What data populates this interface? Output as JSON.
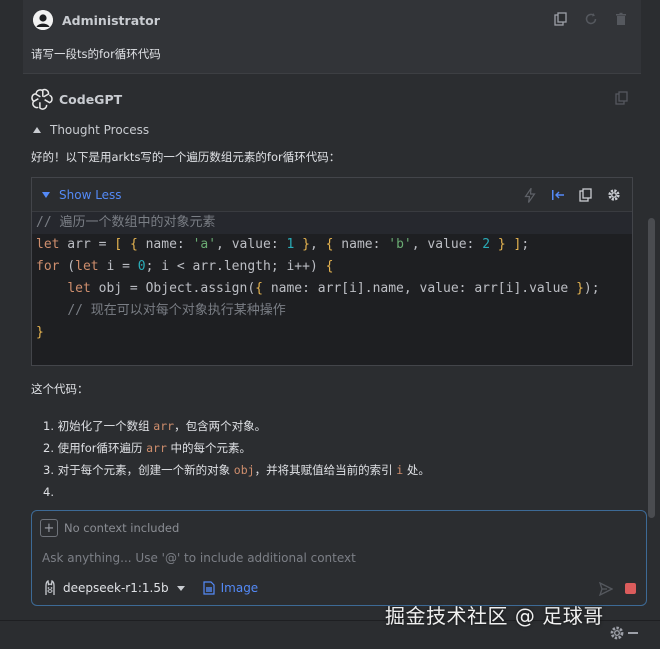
{
  "user": {
    "name": "Administrator",
    "message": "请写一段ts的for循环代码"
  },
  "assistant": {
    "name": "CodeGPT",
    "thought_label": "Thought Process",
    "intro": "好的！以下是用arkts写的一个遍历数组元素的for循环代码：",
    "code_block": {
      "toggle_label": "Show Less",
      "lines": [
        "// 遍历一个数组中的对象元素",
        "let arr = [ { name: 'a', value: 1 }, { name: 'b', value: 2 } ];",
        "for (let i = 0; i < arr.length; i++) {",
        "    let obj = Object.assign({ name: arr[i].name, value: arr[i].value });",
        "    // 现在可以对每个对象执行某种操作",
        "}"
      ]
    },
    "explain_title": "这个代码：",
    "explain_items": [
      {
        "num": "1.",
        "before": "初始化了一个数组 ",
        "code": "arr",
        "after": "，包含两个对象。"
      },
      {
        "num": "2.",
        "before": "使用for循环遍历 ",
        "code": "arr",
        "after": " 中的每个元素。"
      },
      {
        "num": "3.",
        "before": "对于每个元素，创建一个新的对象 ",
        "code": "obj",
        "after": "，并将其赋值给当前的索引 ",
        "code2": "i",
        "after2": " 处。"
      },
      {
        "num": "4.",
        "before": "",
        "code": "",
        "after": ""
      }
    ]
  },
  "input": {
    "context_text": "No context included",
    "placeholder": "Ask anything... Use '@' to include additional context",
    "value": "",
    "model": "deepseek-r1:1.5b",
    "image_label": "Image"
  },
  "watermark": "掘金技术社区 @ 足球哥",
  "colors": {
    "background": "#2b2d30",
    "code_background": "#1e1f22",
    "accent": "#548af7",
    "keyword": "#cf8e6d",
    "string": "#6aab73",
    "number": "#2aacb8",
    "stop": "#db5c5c"
  }
}
